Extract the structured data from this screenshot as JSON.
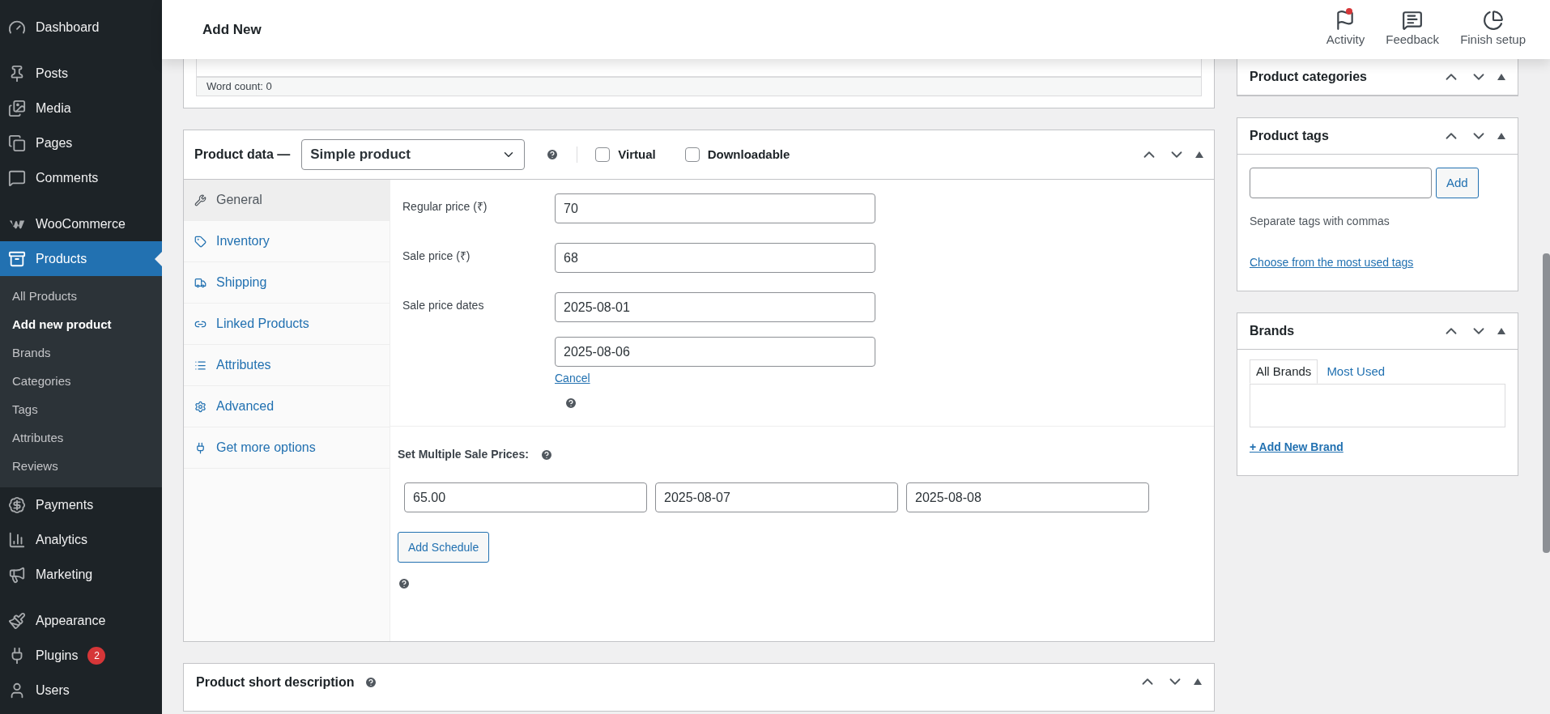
{
  "sidebar": {
    "groups": [
      [
        {
          "label": "Dashboard",
          "selected": false
        }
      ],
      [
        {
          "label": "Posts",
          "selected": false
        },
        {
          "label": "Media",
          "selected": false
        },
        {
          "label": "Pages",
          "selected": false
        },
        {
          "label": "Comments",
          "selected": false
        }
      ],
      [
        {
          "label": "WooCommerce",
          "selected": false
        },
        {
          "label": "Products",
          "selected": true,
          "children": [
            {
              "label": "All Products",
              "selected": false
            },
            {
              "label": "Add new product",
              "selected": true
            },
            {
              "label": "Brands",
              "selected": false
            },
            {
              "label": "Categories",
              "selected": false
            },
            {
              "label": "Tags",
              "selected": false
            },
            {
              "label": "Attributes",
              "selected": false
            },
            {
              "label": "Reviews",
              "selected": false
            }
          ]
        },
        {
          "label": "Payments",
          "selected": false
        },
        {
          "label": "Analytics",
          "selected": false
        },
        {
          "label": "Marketing",
          "selected": false
        }
      ],
      [
        {
          "label": "Appearance",
          "selected": false
        },
        {
          "label": "Plugins",
          "selected": false,
          "badge": "2"
        },
        {
          "label": "Users",
          "selected": false
        }
      ]
    ]
  },
  "header": {
    "title": "Add New",
    "actions": [
      {
        "label": "Activity",
        "notification": true
      },
      {
        "label": "Feedback",
        "notification": false
      },
      {
        "label": "Finish setup",
        "notification": false
      }
    ]
  },
  "editor": {
    "word_count": "Word count: 0"
  },
  "product_data": {
    "title": "Product data —",
    "type_select": "Simple product",
    "options": [
      {
        "label": "Virtual",
        "checked": false
      },
      {
        "label": "Downloadable",
        "checked": false
      }
    ],
    "tabs": [
      {
        "label": "General",
        "selected": true
      },
      {
        "label": "Inventory",
        "selected": false
      },
      {
        "label": "Shipping",
        "selected": false
      },
      {
        "label": "Linked Products",
        "selected": false
      },
      {
        "label": "Attributes",
        "selected": false
      },
      {
        "label": "Advanced",
        "selected": false
      },
      {
        "label": "Get more options",
        "selected": false
      }
    ],
    "fields": [
      {
        "label": "Regular price (₹)",
        "values": [
          "70"
        ]
      },
      {
        "label": "Sale price (₹)",
        "values": [
          "68"
        ]
      },
      {
        "label": "Sale price dates",
        "values": [
          "2025-08-01",
          "2025-08-06"
        ],
        "link": "Cancel"
      }
    ],
    "schedule": {
      "label": "Set Multiple Sale Prices:",
      "values": [
        "65.00",
        "2025-08-07",
        "2025-08-08"
      ],
      "button": "Add Schedule"
    }
  },
  "short_description": {
    "title": "Product short description"
  },
  "side_panels": {
    "categories": {
      "title": "Product categories"
    },
    "tags": {
      "title": "Product tags",
      "button": "Add",
      "hint": "Separate tags with commas",
      "link": "Choose from the most used tags"
    },
    "brands": {
      "title": "Brands",
      "tabs": [
        {
          "label": "All Brands",
          "selected": true
        },
        {
          "label": "Most Used",
          "selected": false
        }
      ],
      "link": "+ Add New Brand"
    }
  }
}
